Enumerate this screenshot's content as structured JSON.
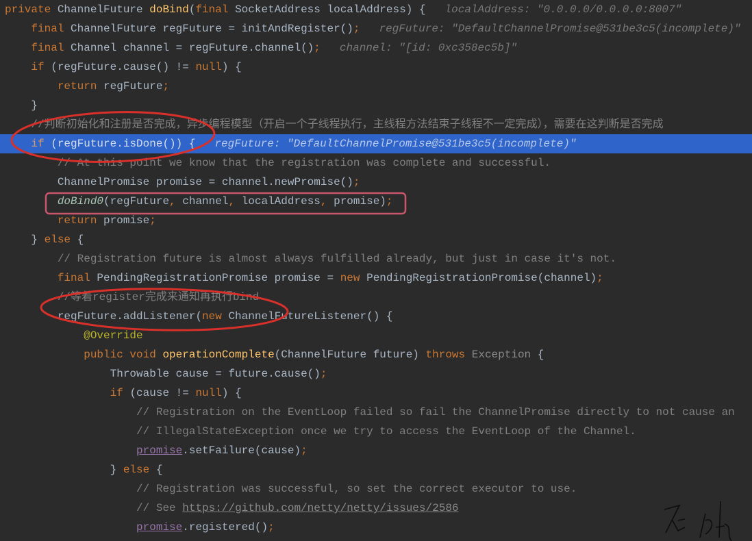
{
  "editor": {
    "highlight_color": "#2f65ca",
    "highlighted_line": 7,
    "lines": [
      {
        "indent": 0,
        "tokens": [
          [
            "k",
            "private "
          ],
          [
            "t",
            "ChannelFuture "
          ],
          [
            "f",
            "doBind"
          ],
          [
            "t",
            "("
          ],
          [
            "k",
            "final "
          ],
          [
            "t",
            "SocketAddress localAddress) {"
          ],
          [
            "h",
            "localAddress: \"0.0.0.0/0.0.0.0:8007\""
          ]
        ]
      },
      {
        "indent": 4,
        "tokens": [
          [
            "k",
            "final "
          ],
          [
            "t",
            "ChannelFuture regFuture = initAndRegister()"
          ],
          [
            "k",
            ";"
          ],
          [
            "h",
            "regFuture: \"DefaultChannelPromise@531be3c5(incomplete)\""
          ]
        ]
      },
      {
        "indent": 4,
        "tokens": [
          [
            "k",
            "final "
          ],
          [
            "t",
            "Channel channel = regFuture.channel()"
          ],
          [
            "k",
            ";"
          ],
          [
            "h",
            "channel: \"[id: 0xc358ec5b]\""
          ]
        ]
      },
      {
        "indent": 4,
        "tokens": [
          [
            "k",
            "if "
          ],
          [
            "t",
            "(regFuture.cause() != "
          ],
          [
            "k",
            "null"
          ],
          [
            "t",
            ") {"
          ]
        ]
      },
      {
        "indent": 8,
        "tokens": [
          [
            "k",
            "return "
          ],
          [
            "t",
            "regFuture"
          ],
          [
            "k",
            ";"
          ]
        ]
      },
      {
        "indent": 4,
        "tokens": [
          [
            "t",
            "}"
          ]
        ]
      },
      {
        "indent": 4,
        "tokens": [
          [
            "c",
            "//判断初始化和注册是否完成，异步编程模型（开启一个子线程执行，主线程方法结束子线程不一定完成），需要在这判断是否完成"
          ]
        ]
      },
      {
        "indent": 4,
        "tokens": [
          [
            "k",
            "if "
          ],
          [
            "t",
            "(regFuture.isDone()) {"
          ],
          [
            "h",
            "regFuture: \"DefaultChannelPromise@531be3c5(incomplete)\""
          ]
        ]
      },
      {
        "indent": 8,
        "tokens": [
          [
            "c",
            "// At this point we know that the registration was complete and successful."
          ]
        ]
      },
      {
        "indent": 8,
        "tokens": [
          [
            "t",
            "ChannelPromise promise = channel.newPromise()"
          ],
          [
            "k",
            ";"
          ]
        ]
      },
      {
        "indent": 8,
        "tokens": [
          [
            "i",
            "doBind0"
          ],
          [
            "t",
            "(regFuture"
          ],
          [
            "k",
            ", "
          ],
          [
            "t",
            "channel"
          ],
          [
            "k",
            ", "
          ],
          [
            "t",
            "localAddress"
          ],
          [
            "k",
            ", "
          ],
          [
            "t",
            "promise)"
          ],
          [
            "k",
            ";"
          ]
        ]
      },
      {
        "indent": 8,
        "tokens": [
          [
            "k",
            "return "
          ],
          [
            "t",
            "promise"
          ],
          [
            "k",
            ";"
          ]
        ]
      },
      {
        "indent": 4,
        "tokens": [
          [
            "t",
            "} "
          ],
          [
            "k",
            "else "
          ],
          [
            "t",
            "{"
          ]
        ]
      },
      {
        "indent": 8,
        "tokens": [
          [
            "c",
            "// Registration future is almost always fulfilled already, but just in case it's not."
          ]
        ]
      },
      {
        "indent": 8,
        "tokens": [
          [
            "k",
            "final "
          ],
          [
            "t",
            "PendingRegistrationPromise promise = "
          ],
          [
            "k",
            "new "
          ],
          [
            "t",
            "PendingRegistrationPromise(channel)"
          ],
          [
            "k",
            ";"
          ]
        ]
      },
      {
        "indent": 8,
        "tokens": [
          [
            "c",
            "//等着register完成来通知再执行bind"
          ]
        ]
      },
      {
        "indent": 8,
        "tokens": [
          [
            "t",
            "regFuture.addListener("
          ],
          [
            "k",
            "new "
          ],
          [
            "t",
            "ChannelFutureListener() {"
          ]
        ]
      },
      {
        "indent": 12,
        "tokens": [
          [
            "a",
            "@Override"
          ]
        ]
      },
      {
        "indent": 12,
        "tokens": [
          [
            "k",
            "public void "
          ],
          [
            "f",
            "operationComplete"
          ],
          [
            "t",
            "(ChannelFuture future) "
          ],
          [
            "k",
            "throws "
          ],
          [
            "g",
            "Exception "
          ],
          [
            "t",
            "{"
          ]
        ]
      },
      {
        "indent": 16,
        "tokens": [
          [
            "t",
            "Throwable cause = future.cause()"
          ],
          [
            "k",
            ";"
          ]
        ]
      },
      {
        "indent": 16,
        "tokens": [
          [
            "k",
            "if "
          ],
          [
            "t",
            "(cause != "
          ],
          [
            "k",
            "null"
          ],
          [
            "t",
            ") {"
          ]
        ]
      },
      {
        "indent": 20,
        "tokens": [
          [
            "c",
            "// Registration on the EventLoop failed so fail the ChannelPromise directly to not cause an"
          ]
        ]
      },
      {
        "indent": 20,
        "tokens": [
          [
            "c",
            "// IllegalStateException once we try to access the EventLoop of the Channel."
          ]
        ]
      },
      {
        "indent": 20,
        "tokens": [
          [
            "p",
            "promise"
          ],
          [
            "t",
            ".setFailure(cause)"
          ],
          [
            "k",
            ";"
          ]
        ]
      },
      {
        "indent": 16,
        "tokens": [
          [
            "t",
            "} "
          ],
          [
            "k",
            "else "
          ],
          [
            "t",
            "{"
          ]
        ]
      },
      {
        "indent": 20,
        "tokens": [
          [
            "c",
            "// Registration was successful, so set the correct executor to use."
          ]
        ]
      },
      {
        "indent": 20,
        "tokens": [
          [
            "c",
            "// See "
          ],
          [
            "l",
            "https://github.com/netty/netty/issues/2586"
          ]
        ]
      },
      {
        "indent": 20,
        "tokens": [
          [
            "p",
            "promise"
          ],
          [
            "t",
            ".registered()"
          ],
          [
            "k",
            ";"
          ]
        ]
      }
    ]
  },
  "annotations": {
    "ellipse_color": "#d9302a",
    "box_color": "#c9566a",
    "signature": "石屹"
  }
}
